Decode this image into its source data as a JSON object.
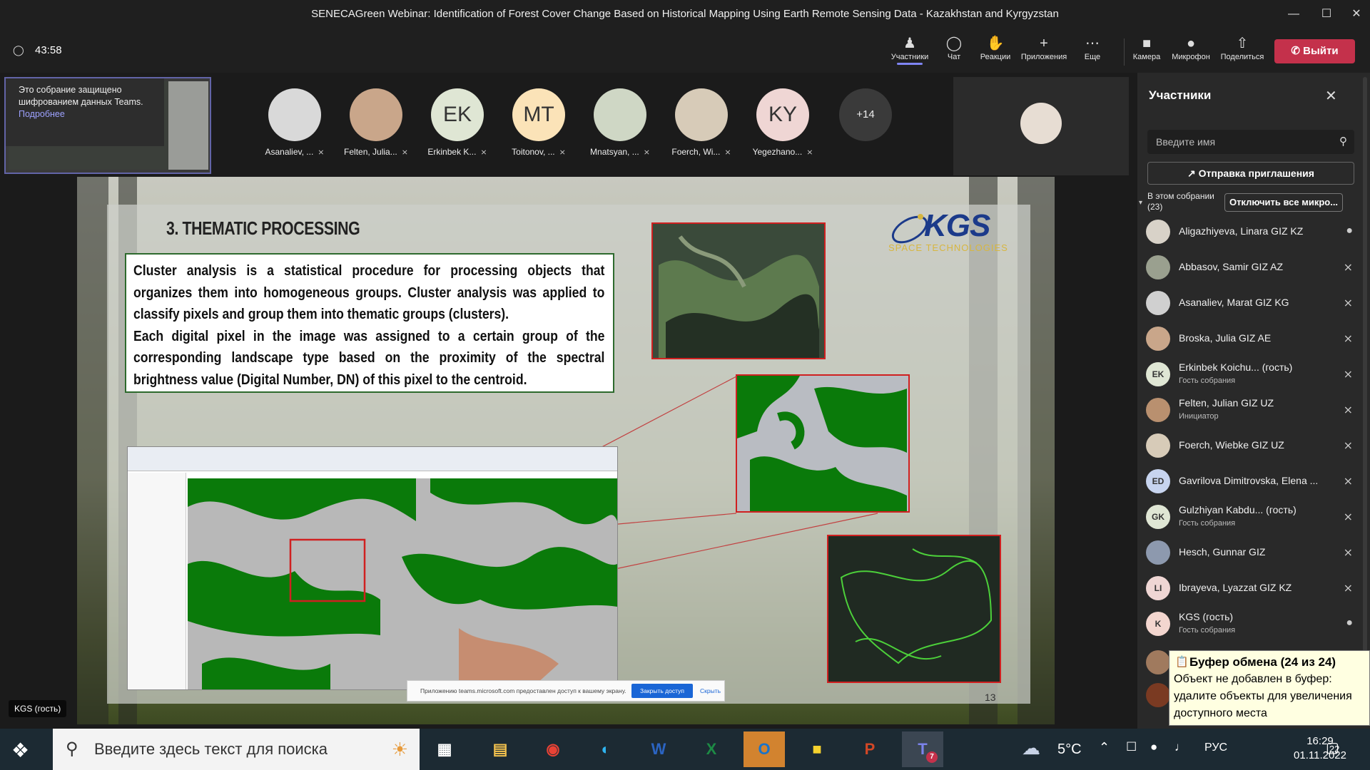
{
  "window": {
    "title": "SENECAGreen Webinar: Identification of Forest Cover Change Based on Historical Mapping Using Earth Remote Sensing Data - Kazakhstan and Kyrgyzstan"
  },
  "meeting": {
    "timer": "43:58",
    "encryption_note": "Это собрание защищено шифрованием данных Teams.",
    "learn_more": "Подробнее",
    "presenter_label": "KGS (гость)"
  },
  "toolbar": {
    "participants": "Участники",
    "chat": "Чат",
    "reactions": "Реакции",
    "apps": "Приложения",
    "more": "Еще",
    "camera": "Камера",
    "mic": "Микрофон",
    "share": "Поделиться",
    "leave": "Выйти"
  },
  "tiles": [
    {
      "name": "Asanaliev, ...",
      "initials": "",
      "color": "#d9d9d9"
    },
    {
      "name": "Felten, Julia...",
      "initials": "",
      "color": "#c9a68a"
    },
    {
      "name": "Erkinbek K...",
      "initials": "EK",
      "color": "#dfe6d4"
    },
    {
      "name": "Toitonov, ...",
      "initials": "MT",
      "color": "#fbe3b8"
    },
    {
      "name": "Mnatsyan, ...",
      "initials": "",
      "color": "#cfd7c5"
    },
    {
      "name": "Foerch, Wi...",
      "initials": "",
      "color": "#d7cbb8"
    },
    {
      "name": "Yegezhano...",
      "initials": "KY",
      "color": "#efd6d4"
    }
  ],
  "more_tiles": "+14",
  "slide": {
    "title": "3. THEMATIC PROCESSING",
    "body_1": "Cluster analysis is a statistical procedure for processing objects that organizes them into homogeneous groups. Cluster analysis was applied to classify pixels and group them into thematic groups (clusters).",
    "body_2": "Each digital pixel in the image was assigned to a certain group of the corresponding landscape type based on the proximity of the spectral brightness value (Digital Number, DN) of this pixel to the centroid.",
    "logo_text": "KGS",
    "logo_sub": "SPACE TECHNOLOGIES",
    "page_number": "13"
  },
  "share_prompt": {
    "text": "Приложению teams.microsoft.com предоставлен доступ к вашему экрану.",
    "stop": "Закрыть доступ",
    "hide": "Скрыть"
  },
  "panel": {
    "title": "Участники",
    "search_placeholder": "Введите имя",
    "invite": "Отправка приглашения",
    "in_meeting": "В этом собрании",
    "count": "(23)",
    "mute_all": "Отключить все микро...",
    "participants": [
      {
        "name": "Aligazhiyeva, Linara GIZ KZ",
        "role": "",
        "initials": "",
        "color": "#d8d2c8",
        "mic": "on"
      },
      {
        "name": "Abbasov, Samir GIZ AZ",
        "role": "",
        "initials": "",
        "color": "#9aa08f",
        "mic": "off"
      },
      {
        "name": "Asanaliev, Marat GIZ KG",
        "role": "",
        "initials": "",
        "color": "#d0d0d0",
        "mic": "off"
      },
      {
        "name": "Broska, Julia GIZ AE",
        "role": "",
        "initials": "",
        "color": "#c9a68a",
        "mic": "off"
      },
      {
        "name": "Erkinbek Koichu... (гость)",
        "role": "Гость собрания",
        "initials": "EK",
        "color": "#dfe6d4",
        "mic": "off"
      },
      {
        "name": "Felten, Julian GIZ UZ",
        "role": "Инициатор",
        "initials": "",
        "color": "#b9906f",
        "mic": "off"
      },
      {
        "name": "Foerch, Wiebke GIZ UZ",
        "role": "",
        "initials": "",
        "color": "#d7cbb8",
        "mic": "off"
      },
      {
        "name": "Gavrilova Dimitrovska, Elena ...",
        "role": "",
        "initials": "ED",
        "color": "#c7d4ef",
        "mic": "off"
      },
      {
        "name": "Gulzhiyan Kabdu... (гость)",
        "role": "Гость собрания",
        "initials": "GK",
        "color": "#dfe6d4",
        "mic": "off"
      },
      {
        "name": "Hesch, Gunnar GIZ",
        "role": "",
        "initials": "",
        "color": "#8d99ae",
        "mic": "off"
      },
      {
        "name": "Ibrayeva, Lyazzat GIZ KZ",
        "role": "",
        "initials": "LI",
        "color": "#efd6d4",
        "mic": "off"
      },
      {
        "name": "KGS (гость)",
        "role": "Гость собрания",
        "initials": "K",
        "color": "#f3d6cf",
        "mic": "on"
      }
    ]
  },
  "clipboard": {
    "title": "Буфер обмена (24 из 24)",
    "body": "Объект не добавлен в буфер: удалите объекты для увеличения доступного места"
  },
  "taskbar": {
    "search_placeholder": "Введите здесь текст для поиска",
    "weather": "5°C",
    "language": "РУС",
    "time": "16:29",
    "date": "01.11.2022",
    "notifications": "22",
    "teams_badge": "7"
  }
}
